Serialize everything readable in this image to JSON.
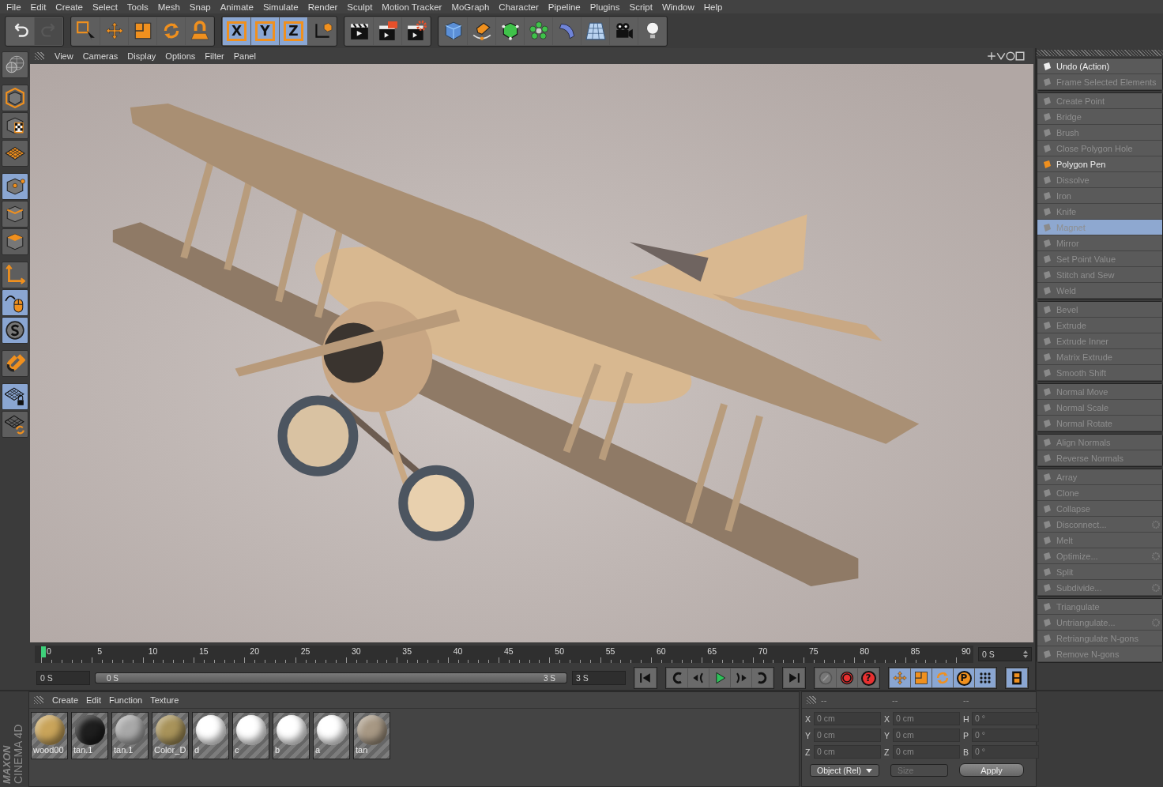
{
  "menu": [
    "File",
    "Edit",
    "Create",
    "Select",
    "Tools",
    "Mesh",
    "Snap",
    "Animate",
    "Simulate",
    "Render",
    "Sculpt",
    "Motion Tracker",
    "MoGraph",
    "Character",
    "Pipeline",
    "Plugins",
    "Script",
    "Window",
    "Help"
  ],
  "toolbar_groups": [
    [
      {
        "kind": "undo",
        "selected": false,
        "disabled": false
      },
      {
        "kind": "redo",
        "selected": false,
        "disabled": true
      }
    ],
    [
      {
        "kind": "select",
        "selected": false,
        "disabled": false
      },
      {
        "kind": "move",
        "selected": false,
        "disabled": false
      },
      {
        "kind": "scale",
        "selected": false,
        "disabled": false
      },
      {
        "kind": "rotate",
        "selected": false,
        "disabled": false
      },
      {
        "kind": "magnet-grid",
        "selected": false,
        "disabled": false
      }
    ],
    [
      {
        "kind": "axis",
        "label": "X",
        "selected": true,
        "disabled": false
      },
      {
        "kind": "axis",
        "label": "Y",
        "selected": true,
        "disabled": false
      },
      {
        "kind": "axis",
        "label": "Z",
        "selected": true,
        "disabled": false
      },
      {
        "kind": "coords",
        "selected": false,
        "disabled": false
      }
    ],
    [
      {
        "kind": "clapper",
        "selected": false,
        "disabled": false
      },
      {
        "kind": "clapper-doc",
        "selected": false,
        "disabled": false
      },
      {
        "kind": "clapper-gear",
        "selected": false,
        "disabled": false
      }
    ],
    [
      {
        "kind": "cube",
        "selected": false,
        "disabled": false
      },
      {
        "kind": "pen",
        "selected": false,
        "disabled": false
      },
      {
        "kind": "subcube",
        "selected": false,
        "disabled": false
      },
      {
        "kind": "flower",
        "selected": false,
        "disabled": false
      },
      {
        "kind": "bend",
        "selected": false,
        "disabled": false
      },
      {
        "kind": "floor",
        "selected": false,
        "disabled": false
      },
      {
        "kind": "camera",
        "selected": false,
        "disabled": false
      },
      {
        "kind": "bulb",
        "selected": false,
        "disabled": false
      }
    ]
  ],
  "left_toolbar": [
    [
      {
        "kind": "globe",
        "selected": false
      }
    ],
    [
      {
        "kind": "cube-outline",
        "selected": false
      },
      {
        "kind": "checker-cube",
        "selected": false
      },
      {
        "kind": "grid-plane",
        "selected": false
      }
    ],
    [
      {
        "kind": "points-cube",
        "selected": true
      },
      {
        "kind": "edges-cube",
        "selected": false
      },
      {
        "kind": "polys-cube",
        "selected": false
      }
    ],
    [
      {
        "kind": "axes",
        "selected": false
      },
      {
        "kind": "mouse",
        "selected": true
      },
      {
        "kind": "s-circle",
        "selected": true
      }
    ],
    [
      {
        "kind": "magnet",
        "selected": false
      }
    ],
    [
      {
        "kind": "grid-lock",
        "selected": true
      },
      {
        "kind": "grid-rotate",
        "selected": false
      }
    ]
  ],
  "viewport": {
    "menu": [
      "View",
      "Cameras",
      "Display",
      "Options",
      "Filter",
      "Panel"
    ]
  },
  "tool_panel": {
    "groups": [
      [
        {
          "label": "Undo (Action)",
          "enabled": true,
          "selected": false,
          "has_options": false
        },
        {
          "label": "Frame Selected Elements",
          "enabled": false,
          "selected": false,
          "has_options": false
        }
      ],
      [
        {
          "label": "Create Point",
          "enabled": false,
          "selected": false,
          "has_options": false
        },
        {
          "label": "Bridge",
          "enabled": false,
          "selected": false,
          "has_options": false
        },
        {
          "label": "Brush",
          "enabled": false,
          "selected": false,
          "has_options": false
        },
        {
          "label": "Close Polygon Hole",
          "enabled": false,
          "selected": false,
          "has_options": false
        },
        {
          "label": "Polygon Pen",
          "enabled": true,
          "selected": false,
          "has_options": false
        },
        {
          "label": "Dissolve",
          "enabled": false,
          "selected": false,
          "has_options": false
        },
        {
          "label": "Iron",
          "enabled": false,
          "selected": false,
          "has_options": false
        },
        {
          "label": "Knife",
          "enabled": false,
          "selected": false,
          "has_options": false
        },
        {
          "label": "Magnet",
          "enabled": false,
          "selected": true,
          "has_options": false
        },
        {
          "label": "Mirror",
          "enabled": false,
          "selected": false,
          "has_options": false
        },
        {
          "label": "Set Point Value",
          "enabled": false,
          "selected": false,
          "has_options": false
        },
        {
          "label": "Stitch and Sew",
          "enabled": false,
          "selected": false,
          "has_options": false
        },
        {
          "label": "Weld",
          "enabled": false,
          "selected": false,
          "has_options": false
        }
      ],
      [
        {
          "label": "Bevel",
          "enabled": false,
          "selected": false,
          "has_options": false
        },
        {
          "label": "Extrude",
          "enabled": false,
          "selected": false,
          "has_options": false
        },
        {
          "label": "Extrude Inner",
          "enabled": false,
          "selected": false,
          "has_options": false
        },
        {
          "label": "Matrix Extrude",
          "enabled": false,
          "selected": false,
          "has_options": false
        },
        {
          "label": "Smooth Shift",
          "enabled": false,
          "selected": false,
          "has_options": false
        }
      ],
      [
        {
          "label": "Normal Move",
          "enabled": false,
          "selected": false,
          "has_options": false
        },
        {
          "label": "Normal Scale",
          "enabled": false,
          "selected": false,
          "has_options": false
        },
        {
          "label": "Normal Rotate",
          "enabled": false,
          "selected": false,
          "has_options": false
        }
      ],
      [
        {
          "label": "Align Normals",
          "enabled": false,
          "selected": false,
          "has_options": false
        },
        {
          "label": "Reverse Normals",
          "enabled": false,
          "selected": false,
          "has_options": false
        }
      ],
      [
        {
          "label": "Array",
          "enabled": false,
          "selected": false,
          "has_options": false
        },
        {
          "label": "Clone",
          "enabled": false,
          "selected": false,
          "has_options": false
        },
        {
          "label": "Collapse",
          "enabled": false,
          "selected": false,
          "has_options": false
        },
        {
          "label": "Disconnect...",
          "enabled": false,
          "selected": false,
          "has_options": true
        },
        {
          "label": "Melt",
          "enabled": false,
          "selected": false,
          "has_options": false
        },
        {
          "label": "Optimize...",
          "enabled": false,
          "selected": false,
          "has_options": true
        },
        {
          "label": "Split",
          "enabled": false,
          "selected": false,
          "has_options": false
        },
        {
          "label": "Subdivide...",
          "enabled": false,
          "selected": false,
          "has_options": true
        }
      ],
      [
        {
          "label": "Triangulate",
          "enabled": false,
          "selected": false,
          "has_options": false
        },
        {
          "label": "Untriangulate...",
          "enabled": false,
          "selected": false,
          "has_options": true
        },
        {
          "label": "Retriangulate N-gons",
          "enabled": false,
          "selected": false,
          "has_options": false
        },
        {
          "label": "Remove N-gons",
          "enabled": false,
          "selected": false,
          "has_options": false
        }
      ]
    ]
  },
  "timeline": {
    "labels": [
      "0",
      "5",
      "10",
      "15",
      "20",
      "25",
      "30",
      "35",
      "40",
      "45",
      "50",
      "55",
      "60",
      "65",
      "70",
      "75",
      "80",
      "85",
      "90"
    ],
    "playhead": {
      "level": 0
    },
    "current": "0 S",
    "start": "0 S",
    "range_start": "0 S",
    "range_end": "3 S",
    "end": "3 S"
  },
  "transport": [
    [
      {
        "kind": "skip-start"
      }
    ],
    [
      {
        "kind": "prev-key"
      },
      {
        "kind": "step-back"
      },
      {
        "kind": "play"
      },
      {
        "kind": "step-forward"
      },
      {
        "kind": "next-key"
      }
    ],
    [
      {
        "kind": "skip-end"
      }
    ],
    [
      {
        "kind": "key",
        "selected": false
      },
      {
        "kind": "record",
        "selected": false
      },
      {
        "kind": "autokey",
        "label": "?",
        "selected": false
      }
    ],
    [
      {
        "kind": "move",
        "selected": true
      },
      {
        "kind": "scale",
        "selected": true
      },
      {
        "kind": "rotate",
        "selected": true
      },
      {
        "kind": "param",
        "label": "P",
        "selected": true
      },
      {
        "kind": "dots",
        "selected": true
      }
    ],
    [
      {
        "kind": "film",
        "selected": true
      }
    ]
  ],
  "materials": {
    "menu": [
      "Create",
      "Edit",
      "Function",
      "Texture"
    ],
    "items": [
      {
        "name": "wood00",
        "color": "#c9a45a"
      },
      {
        "name": "tan.1",
        "color": "#1e1e1e"
      },
      {
        "name": "tan.1",
        "color": "#a8a8a8"
      },
      {
        "name": "Color_D",
        "color": "#a8935a"
      },
      {
        "name": "d",
        "color": "#ffffff"
      },
      {
        "name": "c",
        "color": "#ffffff"
      },
      {
        "name": "b",
        "color": "#ffffff"
      },
      {
        "name": "a",
        "color": "#ffffff"
      },
      {
        "name": "tan",
        "color": "#a79884"
      }
    ]
  },
  "coordinates": {
    "headers": [
      "--",
      "--",
      "--"
    ],
    "columns": [
      [
        {
          "axis": "X",
          "value": "0 cm"
        },
        {
          "axis": "Y",
          "value": "0 cm"
        },
        {
          "axis": "Z",
          "value": "0 cm"
        }
      ],
      [
        {
          "axis": "X",
          "value": "0 cm"
        },
        {
          "axis": "Y",
          "value": "0 cm"
        },
        {
          "axis": "Z",
          "value": "0 cm"
        }
      ],
      [
        {
          "axis": "H",
          "value": "0 °"
        },
        {
          "axis": "P",
          "value": "0 °"
        },
        {
          "axis": "B",
          "value": "0 °"
        }
      ]
    ],
    "mode": "Object (Rel)",
    "size_mode": {
      "label": "Size",
      "disabled": true
    },
    "apply": "Apply"
  },
  "logo": {
    "brand": "MAXON",
    "product": "CINEMA 4D"
  }
}
